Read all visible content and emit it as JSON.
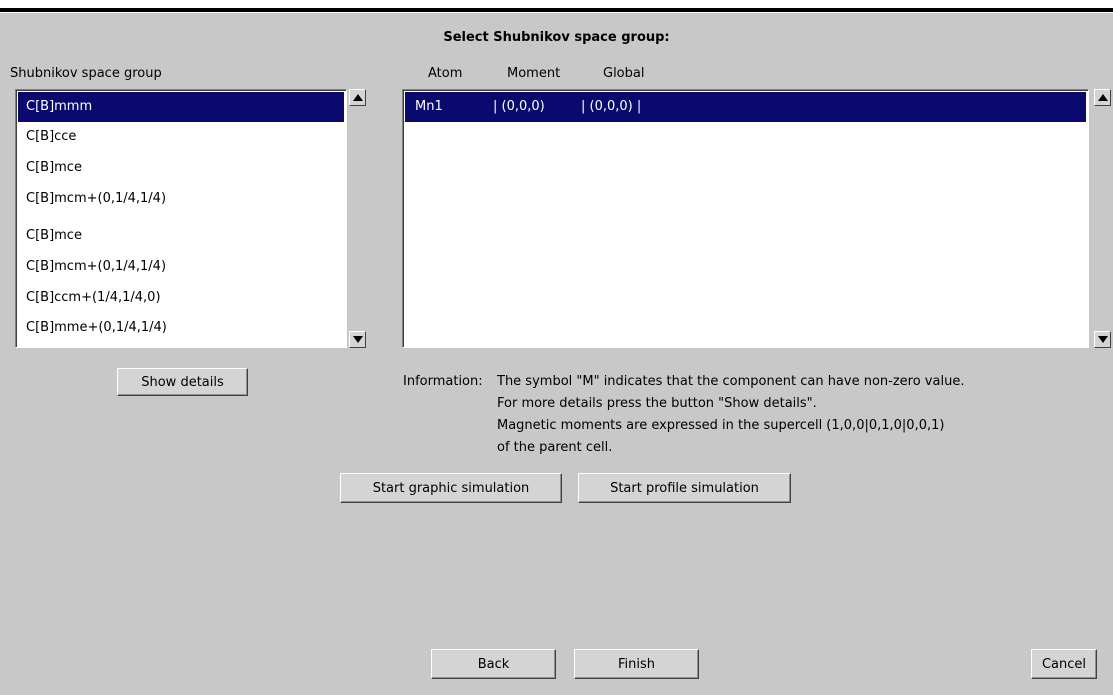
{
  "title": "Select Shubnikov space group:",
  "left_panel": {
    "label": "Shubnikov space group",
    "items": [
      "C[B]mmm",
      "C[B]cce",
      "C[B]mce",
      "C[B]mcm+(0,1/4,1/4)",
      "C[B]mce",
      "C[B]mcm+(0,1/4,1/4)",
      "C[B]ccm+(1/4,1/4,0)",
      "C[B]mme+(0,1/4,1/4)"
    ],
    "selected_index": 0
  },
  "right_panel": {
    "columns": [
      "Atom",
      "Moment",
      "Global"
    ],
    "rows": [
      {
        "atom": "Mn1",
        "moment": "| (0,0,0)",
        "global": "| (0,0,0) |"
      }
    ]
  },
  "buttons": {
    "show_details": "Show details",
    "start_graphic": "Start graphic simulation",
    "start_profile": "Start profile simulation",
    "back": "Back",
    "finish": "Finish",
    "cancel": "Cancel"
  },
  "info": {
    "prefix": "Information:",
    "line1": "The symbol \"M\" indicates that the component can have non-zero value.",
    "line2": "For more details press the button \"Show details\".",
    "line3": "Magnetic moments are expressed in the supercell (1,0,0|0,1,0|0,0,1)",
    "line4": "of the parent cell."
  },
  "icons": {
    "scroll_up": "triangle-up-icon",
    "scroll_down": "triangle-down-icon"
  },
  "colors": {
    "background": "#c8c8c8",
    "selection": "#0a0a6e"
  }
}
